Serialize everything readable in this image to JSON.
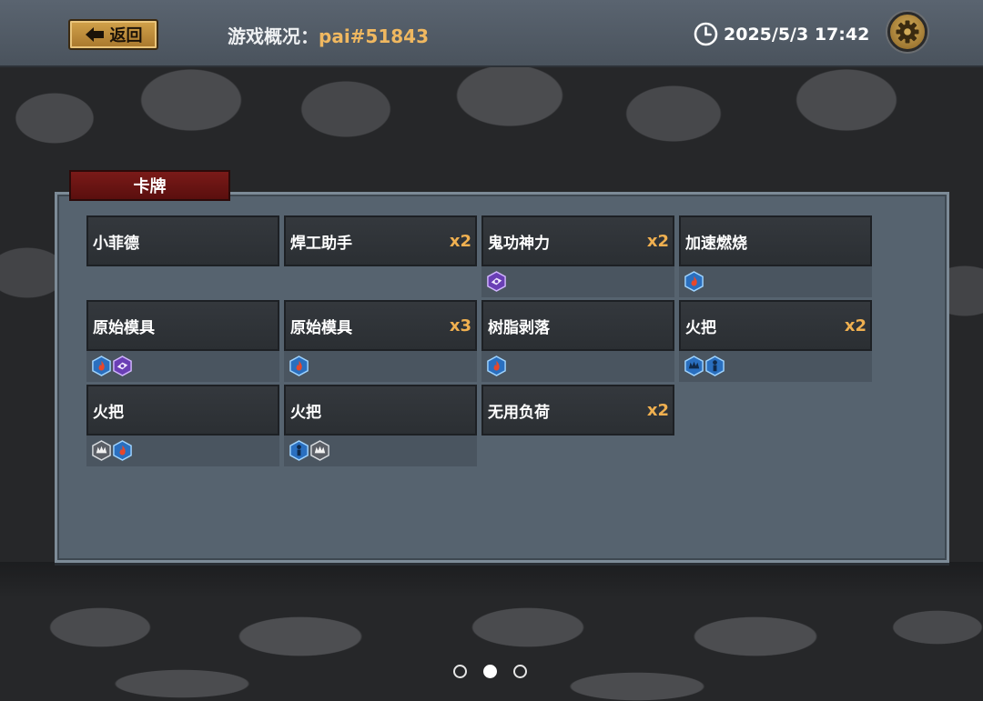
{
  "header": {
    "back_label": "返回",
    "title_prefix": "游戏概况：",
    "player_id": "pai#51843",
    "datetime": "2025/5/3 17:42"
  },
  "panel": {
    "tab_label": "卡牌"
  },
  "cards": [
    {
      "name": "小菲德",
      "count": "",
      "icons": []
    },
    {
      "name": "焊工助手",
      "count": "x2",
      "icons": []
    },
    {
      "name": "鬼功神力",
      "count": "x2",
      "icons": [
        "purple-rune-icon"
      ]
    },
    {
      "name": "加速燃烧",
      "count": "",
      "icons": [
        "fire-rune-icon"
      ]
    },
    {
      "name": "原始模具",
      "count": "",
      "icons": [
        "fire-rune-icon",
        "purple-rune-icon"
      ]
    },
    {
      "name": "原始模具",
      "count": "x3",
      "icons": [
        "fire-rune-icon"
      ]
    },
    {
      "name": "树脂剥落",
      "count": "",
      "icons": [
        "fire-rune-icon"
      ]
    },
    {
      "name": "火把",
      "count": "x2",
      "icons": [
        "blue-crest-rune-icon",
        "blue-figure-rune-icon"
      ]
    },
    {
      "name": "火把",
      "count": "",
      "icons": [
        "gray-crest-rune-icon",
        "fire-rune-icon"
      ]
    },
    {
      "name": "火把",
      "count": "",
      "icons": [
        "blue-figure-rune-icon",
        "gray-crest-rune-icon"
      ]
    },
    {
      "name": "无用负荷",
      "count": "x2",
      "icons": []
    }
  ],
  "pagination": {
    "pages": 3,
    "current": 2
  },
  "colors": {
    "accent_gold": "#f0b860",
    "count_orange": "#f0b050",
    "tab_red": "#7a1a18",
    "panel": "#56636f"
  }
}
